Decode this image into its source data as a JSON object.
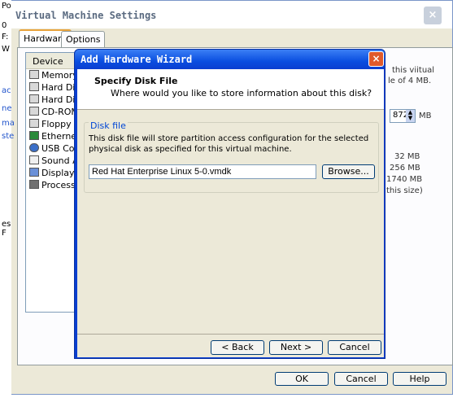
{
  "vm_window": {
    "title": "Virtual Machine Settings",
    "close_glyph": "×",
    "tabs": [
      "Hardware",
      "Options"
    ],
    "device_header": "Device",
    "devices": [
      "Memory",
      "Hard Disk",
      "Hard Disk",
      "CD-ROM",
      "Floppy",
      "Ethernet",
      "USB Con",
      "Sound Ac",
      "Display",
      "Processo"
    ],
    "memory_text_1": "this viitual",
    "memory_text_2": "le of 4 MB.",
    "memory_value": "872",
    "memory_unit": "MB",
    "mem_32": "32 MB",
    "mem_256": "256 MB",
    "mem_1740": "1740 MB",
    "mem_size_note": "this size)",
    "buttons": {
      "ok": "OK",
      "cancel": "Cancel",
      "help": "Help"
    }
  },
  "left_fragments": [
    "Po",
    "0",
    "F:",
    "W",
    "ac",
    "ne",
    "ma",
    "ste",
    "es F"
  ],
  "wizard": {
    "title": "Add Hardware Wizard",
    "close_glyph": "×",
    "header_title": "Specify Disk File",
    "header_subtitle": "Where would you like to store information about this disk?",
    "group_label": "Disk file",
    "description": "This disk file will store partition access configuration for the selected physical disk as specified for this virtual machine.",
    "file_value": "Red Hat Enterprise Linux 5-0.vmdk",
    "browse_label": "Browse...",
    "back_label": "< Back",
    "next_label": "Next >",
    "cancel_label": "Cancel"
  },
  "colors": {
    "wizard_frame": "#0a3ed0",
    "dialog_face": "#ece9d8",
    "group_label": "#0046d5"
  }
}
